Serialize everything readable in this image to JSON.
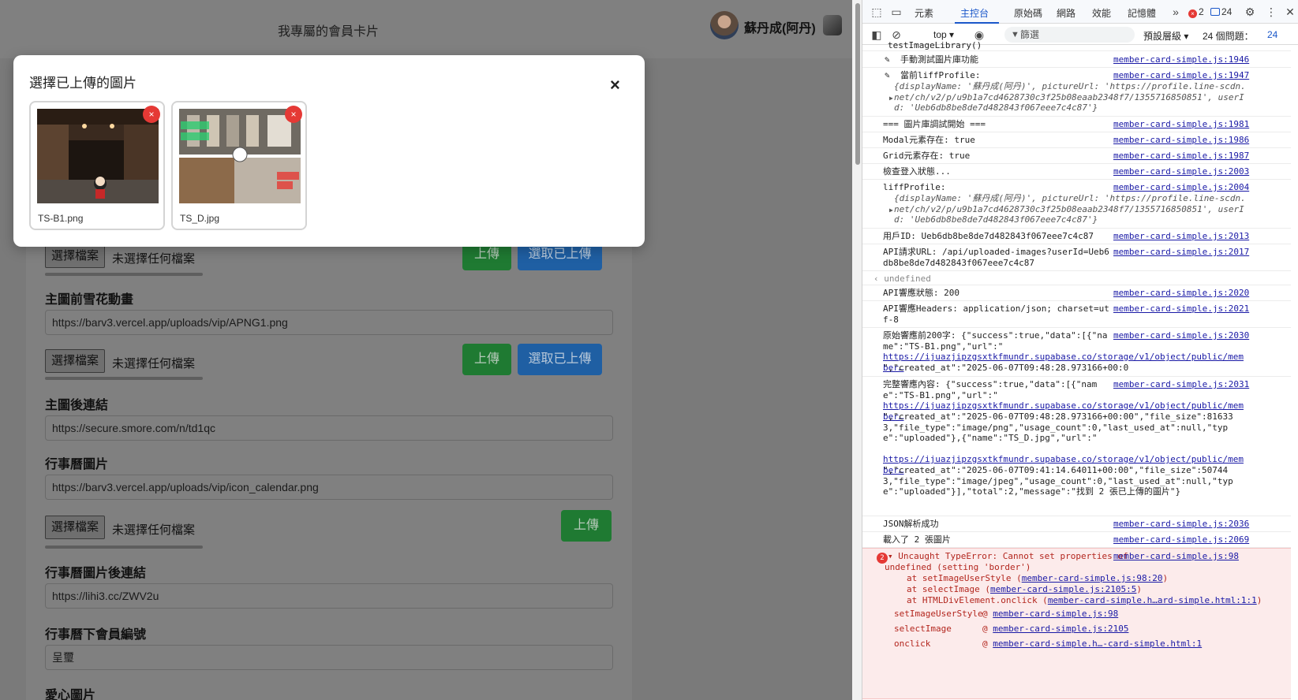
{
  "page": {
    "title": "我專屬的會員卡片",
    "user_name": "蘇丹成(阿丹)",
    "fields": [
      {
        "label": "主圖前雪花動畫",
        "value": "https://barv3.vercel.app/uploads/vip/APNG1.png"
      },
      {
        "label": "主圖後連結",
        "value": "https://secure.smore.com/n/td1qc"
      },
      {
        "label": "行事曆圖片",
        "value": "https://barv3.vercel.app/uploads/vip/icon_calendar.png"
      },
      {
        "label": "行事曆圖片後連結",
        "value": "https://lihi3.cc/ZWV2u"
      },
      {
        "label": "行事曆下會員編號",
        "value": "呈璽"
      },
      {
        "label": "愛心圖片",
        "value": ""
      }
    ],
    "file_button": "選擇檔案",
    "file_status": "未選擇任何檔案",
    "upload_button": "上傳",
    "select_uploaded_button": "選取已上傳"
  },
  "modal": {
    "title": "選擇已上傳的圖片",
    "close": "×",
    "images": [
      {
        "name": "TS-B1.png",
        "delete": "×"
      },
      {
        "name": "TS_D.jpg",
        "delete": "×"
      }
    ]
  },
  "devtools": {
    "tabs": [
      "元素",
      "主控台",
      "原始碼",
      "網路",
      "效能",
      "記憶體"
    ],
    "active_tab": "主控台",
    "error_count": "2",
    "message_count": "24",
    "context": "top",
    "filter_placeholder": "篩選",
    "levels": "預設層級",
    "issues_label": "24 個問題：",
    "issues_count": "24",
    "logs": [
      {
        "msg": "testImageLibrary()",
        "src": ""
      },
      {
        "msg": "手動測試圖片庫功能",
        "src": "member-card-simple.js:1946"
      },
      {
        "msg": "當前liffProfile:",
        "src": "member-card-simple.js:1947"
      },
      {
        "msg": "=== 圖片庫調試開始 ===",
        "src": "member-card-simple.js:1981"
      },
      {
        "msg": "Modal元素存在: true",
        "src": "member-card-simple.js:1986"
      },
      {
        "msg": "Grid元素存在: true",
        "src": "member-card-simple.js:1987"
      },
      {
        "msg": "檢查登入狀態...",
        "src": "member-card-simple.js:2003"
      },
      {
        "msg": "liffProfile:",
        "src": "member-card-simple.js:2004"
      },
      {
        "msg": "用戶ID: Ueb6db8be8de7d482843f067eee7c4c87",
        "src": "member-card-simple.js:2013"
      },
      {
        "msg": "API請求URL: /api/uploaded-images?userId=Ueb6db8be8de7d482843f067eee7c4c87",
        "src": "member-card-simple.js:2017"
      },
      {
        "msg": "undefined",
        "src": ""
      },
      {
        "msg": "API響應狀態: 200",
        "src": "member-card-simple.js:2020"
      },
      {
        "msg": "API響應Headers: application/json; charset=utf-8",
        "src": "member-card-simple.js:2021"
      },
      {
        "msg": "原始響應前200字: {\"success\":true,\"data\":[{\"name\":\"TS-B1.png\",\"url\":\"",
        "src": "member-card-simple.js:2030"
      },
      {
        "msg": "完整響應內容: {\"success\":true,\"data\":[{\"name\":\"TS-B1.png\",\"url\":\"",
        "src": "member-card-simple.js:2031"
      },
      {
        "msg": "JSON解析成功",
        "src": "member-card-simple.js:2036"
      },
      {
        "msg": "載入了 2 張圖片",
        "src": "member-card-simple.js:2069"
      }
    ],
    "profile_obj_1": "{displayName: '蘇丹成(阿丹)', pictureUrl: 'https://profile.line-scdn.net/ch/v2/p/u9b1a7cd4628730c3f25b08eaab2348f7/1355716850851', userId: 'Ueb6db8be8de7d482843f067eee7c4c87'}",
    "profile_obj_2": "{displayName: '蘇丹成(阿丹)', pictureUrl: 'https://profile.line-scdn.net/ch/v2/p/u9b1a7cd4628730c3f25b08eaab2348f7/1355716850851', userId: 'Ueb6db8be8de7d482843f067eee7c4c87'}",
    "raw_link": "https://ijuazjipzgsxtkfmundr.supabase.co/storage/v1/object/public/member…",
    "raw_tail": "\",\"created_at\":\"2025-06-07T09:48:28.973166+00:0",
    "full_tail_1": "\",\"created_at\":\"2025-06-07T09:48:28.973166+00:00\",\"file_size\":816333,\"file_type\":\"image/png\",\"usage_count\":0,\"last_used_at\":null,\"type\":\"uploaded\"},{\"name\":\"TS_D.jpg\",\"url\":\"",
    "full_tail_2": "\",\"created_at\":\"2025-06-07T09:41:14.64011+00:00\",\"file_size\":507443,\"file_type\":\"image/jpeg\",\"usage_count\":0,\"last_used_at\":null,\"type\":\"uploaded\"}],\"total\":2,\"message\":\"找到 2 張已上傳的圖片\"}",
    "error": {
      "count": "2",
      "header": "Uncaught TypeError: Cannot set properties of",
      "src": "member-card-simple.js:98",
      "line2": "undefined (setting 'border')",
      "stack": [
        {
          "prefix": "at setImageUserStyle (",
          "link": "member-card-simple.js:98:20",
          "suffix": ")"
        },
        {
          "prefix": "at selectImage (",
          "link": "member-card-simple.js:2105:5",
          "suffix": ")"
        },
        {
          "prefix": "at HTMLDivElement.onclick (",
          "link": "member-card-simple.h…ard-simple.html:1:1",
          "suffix": ")"
        }
      ],
      "frames": [
        {
          "fn": "setImageUserStyle",
          "link": "member-card-simple.js:98"
        },
        {
          "fn": "selectImage",
          "link": "member-card-simple.js:2105"
        },
        {
          "fn": "onclick",
          "link": "member-card-simple.h…-card-simple.html:1"
        }
      ]
    }
  }
}
